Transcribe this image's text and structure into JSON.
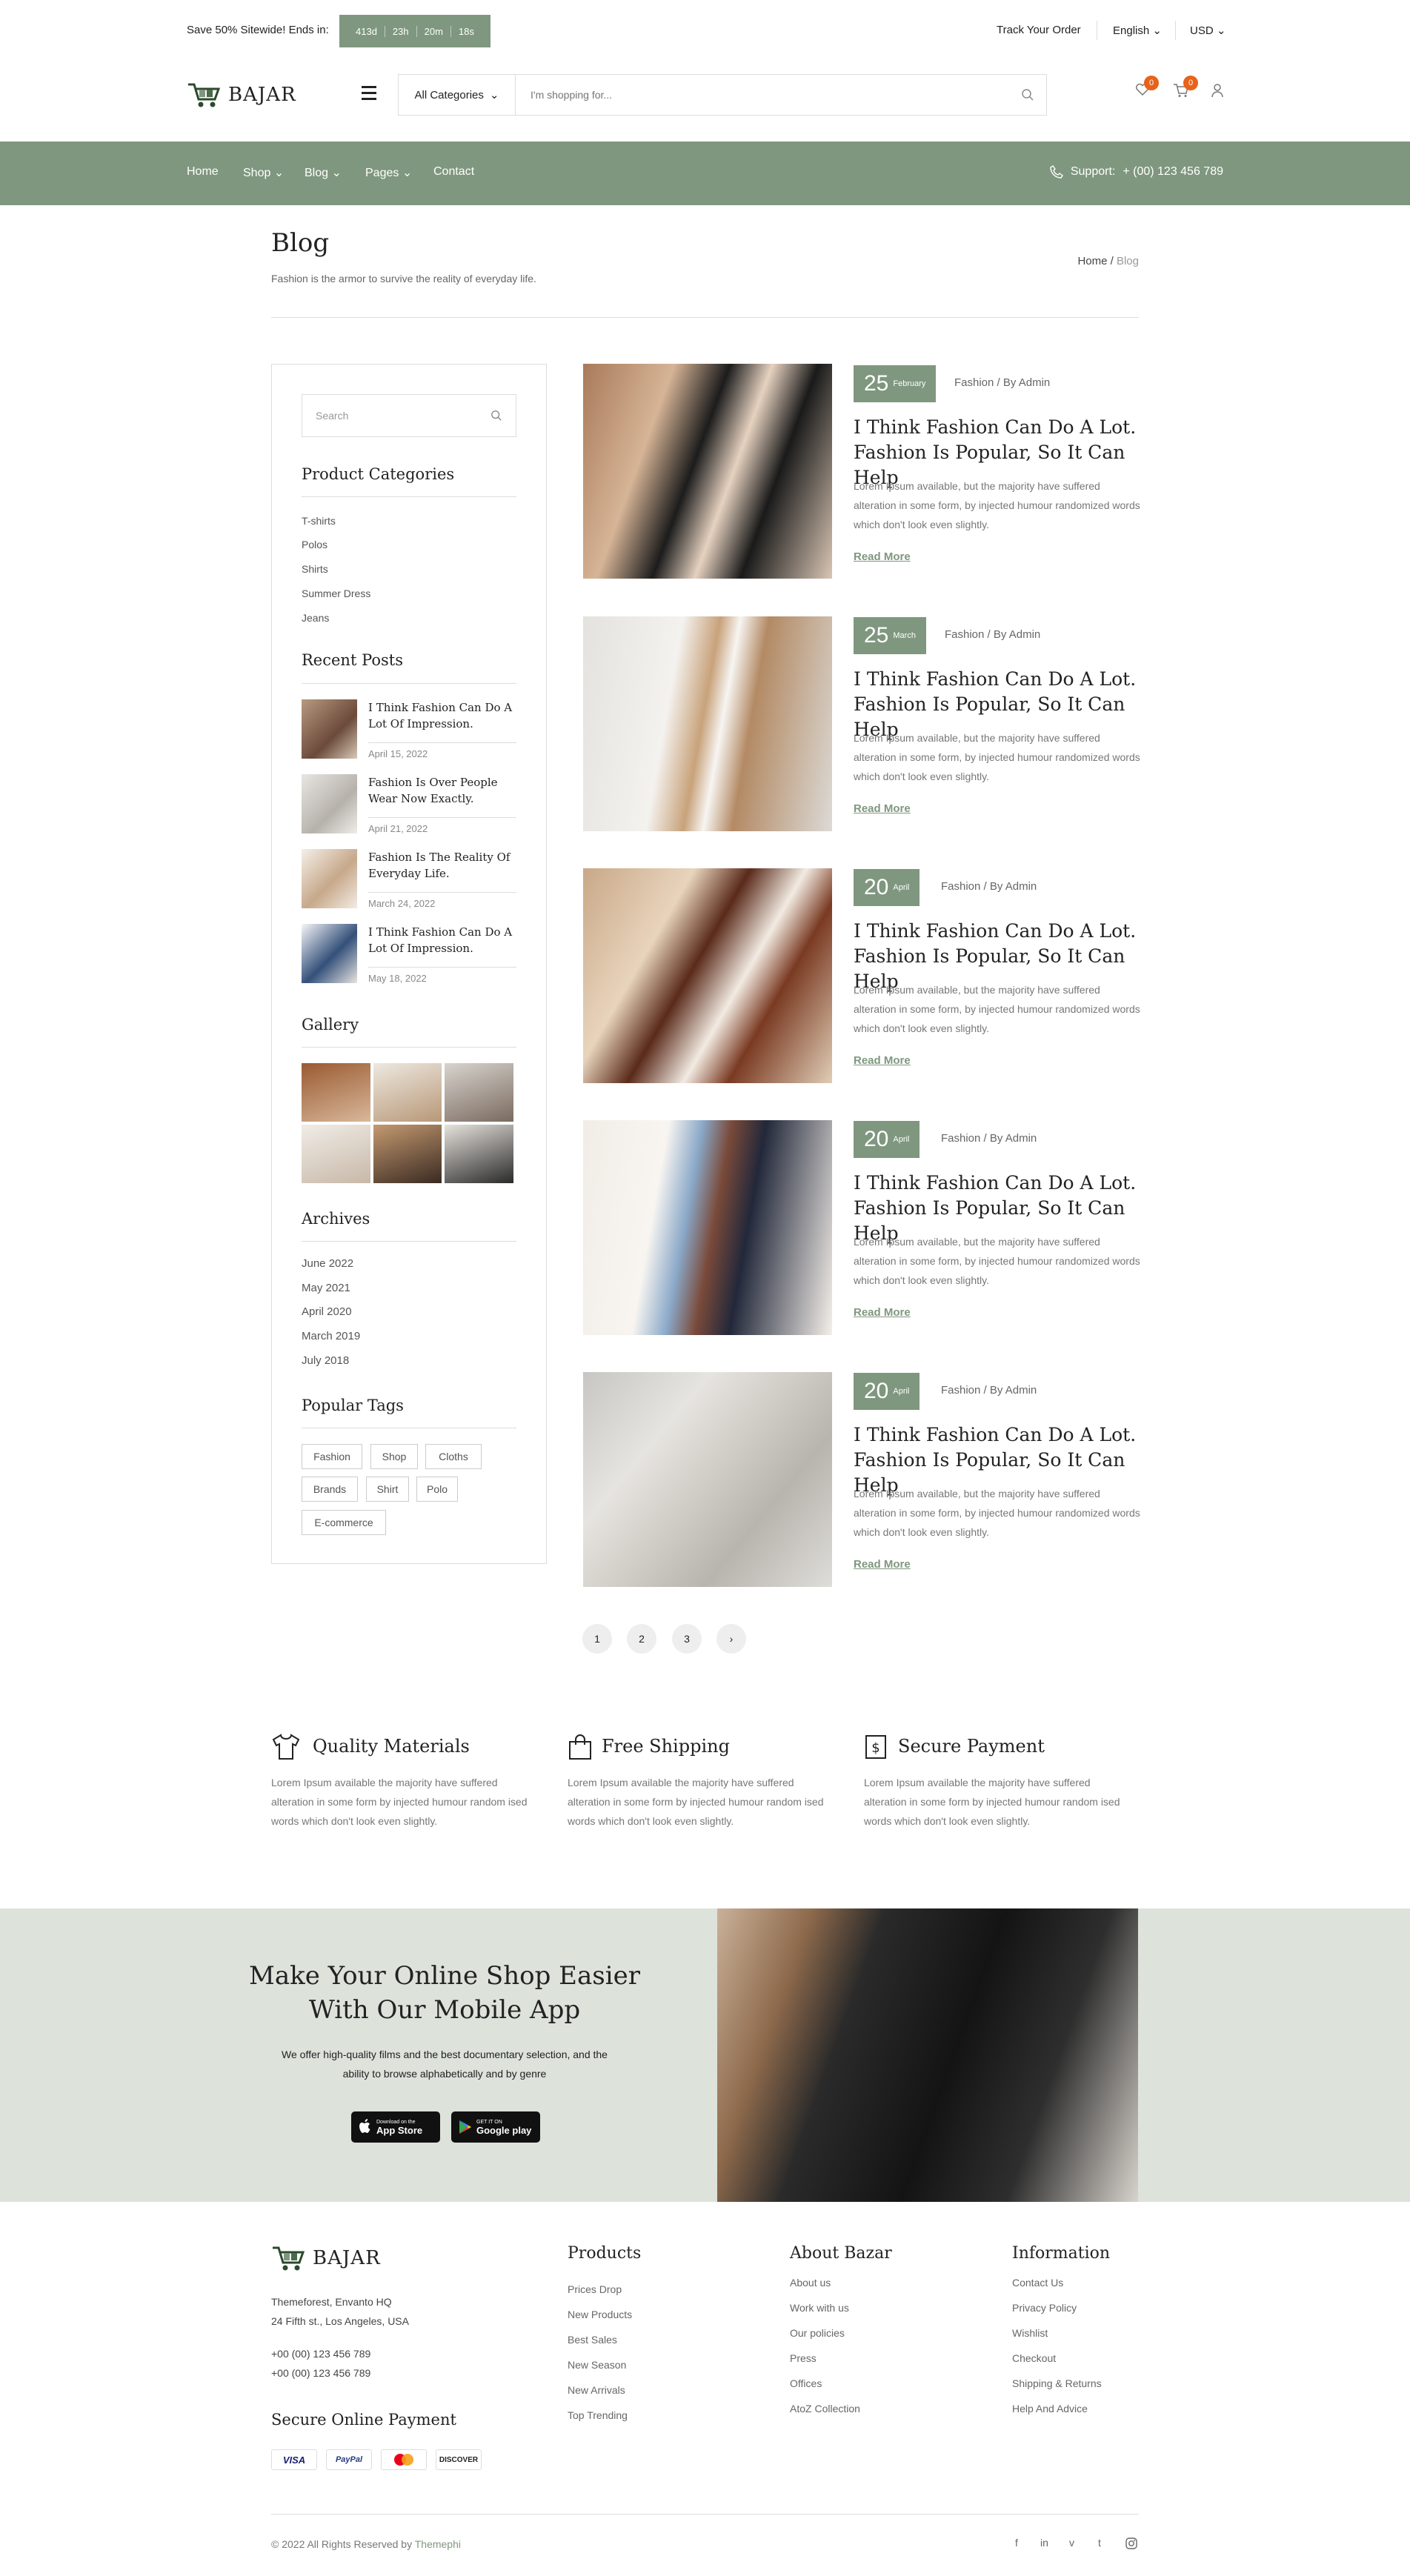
{
  "topbar": {
    "promo": "Save 50% Sitewide! Ends in:",
    "timer": [
      "413d",
      "23h",
      "20m",
      "18s"
    ],
    "track_order": "Track Your Order",
    "language": "English",
    "currency": "USD"
  },
  "header": {
    "logo": "BAJAR",
    "category": "All Categories",
    "search_placeholder": "I'm shopping for...",
    "wishlist_count": "0",
    "cart_count": "0"
  },
  "nav": {
    "items": [
      "Home",
      "Shop",
      "Blog",
      "Pages",
      "Contact"
    ],
    "support_label": "Support:",
    "support_phone": "+ (00) 123 456 789"
  },
  "page": {
    "title": "Blog",
    "subtitle": "Fashion is the armor to survive the reality of everyday life.",
    "crumb_home": "Home",
    "crumb_current": "Blog"
  },
  "sidebar": {
    "search_placeholder": "Search",
    "categories_title": "Product Categories",
    "categories": [
      "T-shirts",
      "Polos",
      "Shirts",
      "Summer Dress",
      "Jeans"
    ],
    "recent_title": "Recent Posts",
    "recent": [
      {
        "title": "I Think Fashion Can Do A Lot Of Impression.",
        "date": "April 15, 2022"
      },
      {
        "title": "Fashion Is Over People Wear Now Exactly.",
        "date": "April 21, 2022"
      },
      {
        "title": "Fashion Is The Reality Of Everyday Life.",
        "date": "March 24, 2022"
      },
      {
        "title": "I Think Fashion Can Do A Lot Of Impression.",
        "date": "May 18, 2022"
      }
    ],
    "gallery_title": "Gallery",
    "archives_title": "Archives",
    "archives": [
      "June 2022",
      "May 2021",
      "April 2020",
      "March 2019",
      "July 2018"
    ],
    "tags_title": "Popular Tags",
    "tags": [
      "Fashion",
      "Shop",
      "Cloths",
      "Brands",
      "Shirt",
      "Polo",
      "E-commerce"
    ]
  },
  "posts": [
    {
      "day": "25",
      "month": "February",
      "category": "Fashion",
      "author": "By Admin",
      "title": "I Think Fashion Can Do A Lot. Fashion Is Popular, So It Can Help",
      "body": "Lorem Ipsum available, but the majority have suffered alteration in some form, by injected humour randomized words which don't look even slightly.",
      "more": "Read More"
    },
    {
      "day": "25",
      "month": "March",
      "category": "Fashion",
      "author": "By Admin",
      "title": "I Think Fashion Can Do A Lot. Fashion Is Popular, So It Can Help",
      "body": "Lorem Ipsum available, but the majority have suffered alteration in some form, by injected humour randomized words which don't look even slightly.",
      "more": "Read More"
    },
    {
      "day": "20",
      "month": "April",
      "category": "Fashion",
      "author": "By Admin",
      "title": "I Think Fashion Can Do A Lot. Fashion Is Popular, So It Can Help",
      "body": "Lorem Ipsum available, but the majority have suffered alteration in some form, by injected humour randomized words which don't look even slightly.",
      "more": "Read More"
    },
    {
      "day": "20",
      "month": "April",
      "category": "Fashion",
      "author": "By Admin",
      "title": "I Think Fashion Can Do A Lot. Fashion Is Popular, So It Can Help",
      "body": "Lorem Ipsum available, but the majority have suffered alteration in some form, by injected humour randomized words which don't look even slightly.",
      "more": "Read More"
    },
    {
      "day": "20",
      "month": "April",
      "category": "Fashion",
      "author": "By Admin",
      "title": "I Think Fashion Can Do A Lot. Fashion Is Popular, So It Can Help",
      "body": "Lorem Ipsum available, but the majority have suffered alteration in some form, by injected humour randomized words which don't look even slightly.",
      "more": "Read More"
    }
  ],
  "pagination": [
    "1",
    "2",
    "3",
    "›"
  ],
  "features": [
    {
      "icon": "tshirt-icon",
      "title": "Quality Materials",
      "body": "Lorem Ipsum available the majority have suffered alteration in some form by injected humour random ised words which don't look even slightly."
    },
    {
      "icon": "bag-icon",
      "title": "Free Shipping",
      "body": "Lorem Ipsum available the majority have suffered alteration in some form by injected humour random ised words which don't look even slightly."
    },
    {
      "icon": "dollar-icon",
      "title": "Secure Payment",
      "body": "Lorem Ipsum available the majority have suffered alteration in some form by injected humour random ised words which don't look even slightly."
    }
  ],
  "banner": {
    "heading_line1": "Make Your Online Shop Easier",
    "heading_line2": "With Our Mobile App",
    "body": "We offer high-quality films and the best documentary selection, and the ability to browse alphabetically and by genre",
    "appstore_small": "Download on the",
    "appstore_big": "App Store",
    "gplay_small": "GET IT ON",
    "gplay_big": "Google play"
  },
  "footer": {
    "logo": "BAJAR",
    "address1": "Themeforest, Envanto HQ",
    "address2": "24 Fifth st., Los Angeles, USA",
    "phone1": "+00 (00) 123 456 789",
    "phone2": "+00 (00) 123 456 789",
    "secure_title": "Secure Online Payment",
    "payments": [
      "VISA",
      "PayPal",
      "MC",
      "DISCOVER"
    ],
    "columns": [
      {
        "title": "Products",
        "links": [
          "Prices Drop",
          "New Products",
          "Best Sales",
          "New Season",
          "New Arrivals",
          "Top Trending"
        ]
      },
      {
        "title": "About Bazar",
        "links": [
          "About us",
          "Work with us",
          "Our policies",
          "Press",
          "Offices",
          "AtoZ Collection"
        ]
      },
      {
        "title": "Information",
        "links": [
          "Contact Us",
          "Privacy Policy",
          "Wishlist",
          "Checkout",
          "Shipping & Returns",
          "Help And Advice"
        ]
      }
    ],
    "copyright": "© 2022 All Rights Reserved by",
    "brand": "Themephi",
    "social": [
      "f",
      "in",
      "v",
      "t",
      "ig"
    ]
  },
  "colors": {
    "accent": "#7f977f",
    "badge": "#e8621a",
    "banner_bg": "#dde2db"
  }
}
